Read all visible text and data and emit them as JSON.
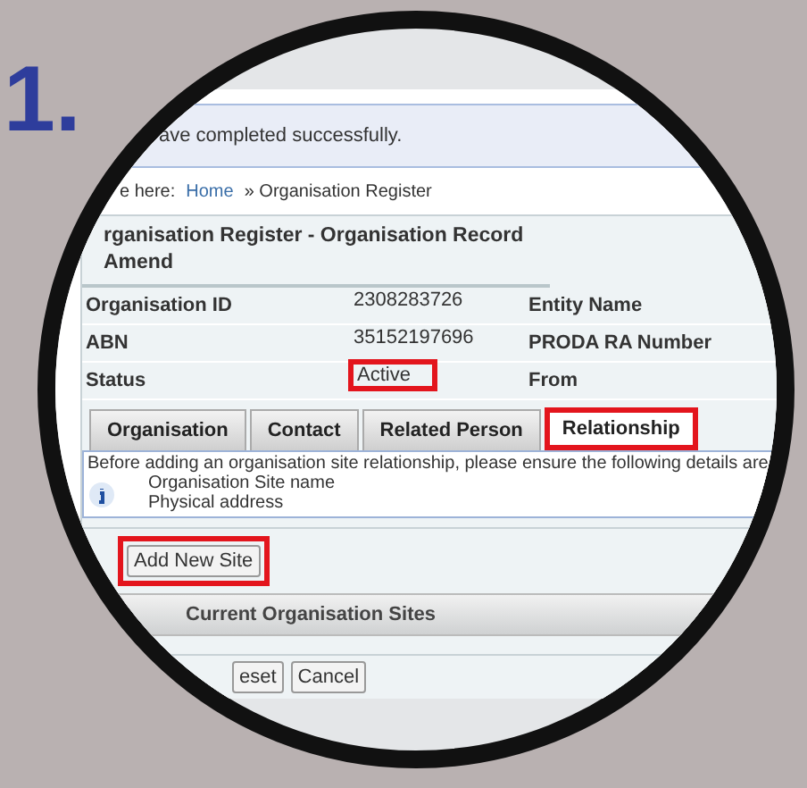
{
  "step_number": "1.",
  "message": "ave completed successfully.",
  "breadcrumb": {
    "prefix": "e here:",
    "links": [
      "Home"
    ],
    "current": "» Organisation Register"
  },
  "record": {
    "title": "rganisation Register - Organisation Record Amend",
    "fields": [
      {
        "label": "Organisation ID",
        "value": "2308283726",
        "label_2": "Entity Name",
        "highlighted": false
      },
      {
        "label": "ABN",
        "value": "35152197696",
        "label_2": "PRODA RA Number",
        "highlighted": false
      },
      {
        "label": "Status",
        "value": "Active",
        "label_2": "From",
        "highlighted": true
      }
    ]
  },
  "tabs": [
    {
      "label": "Organisation",
      "selected": false,
      "highlighted": false
    },
    {
      "label": "Contact",
      "selected": false,
      "highlighted": false
    },
    {
      "label": "Related Person",
      "selected": false,
      "highlighted": false
    },
    {
      "label": "Relationship",
      "selected": true,
      "highlighted": true
    }
  ],
  "info": {
    "text": "Before adding an organisation site relationship, please ensure the following details are",
    "items": [
      "Organisation Site name",
      "Physical address"
    ]
  },
  "add_button": {
    "label": "Add New Site",
    "highlighted": true
  },
  "section_title": "Current Organisation Sites",
  "buttons": [
    "eset",
    "Cancel"
  ]
}
